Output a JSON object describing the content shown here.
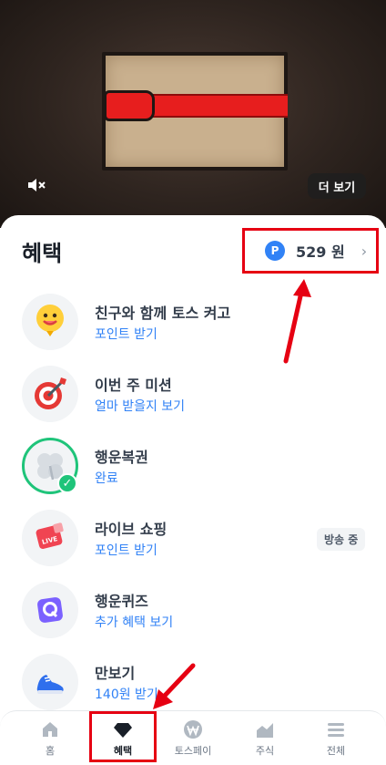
{
  "hero": {
    "more_label": "더 보기",
    "mute_icon": "speaker-muted-icon"
  },
  "benefits": {
    "title": "혜택",
    "points": {
      "badge": "P",
      "value": "529 원"
    },
    "items": [
      {
        "title": "친구와 함께 토스 켜고",
        "subtitle": "포인트 받기",
        "icon": "face-balloon-icon"
      },
      {
        "title": "이번 주 미션",
        "subtitle": "얼마 받을지 보기",
        "icon": "target-dart-icon"
      },
      {
        "title": "행운복권",
        "subtitle": "완료",
        "icon": "clover-icon",
        "done": true
      },
      {
        "title": "라이브 쇼핑",
        "subtitle": "포인트 받기",
        "icon": "live-shopping-icon",
        "badge": "방송 중"
      },
      {
        "title": "행운퀴즈",
        "subtitle": "추가 혜택 보기",
        "icon": "quiz-q-icon"
      },
      {
        "title": "만보기",
        "subtitle": "140원 받기",
        "icon": "sneaker-icon"
      }
    ]
  },
  "tabbar": {
    "tabs": [
      {
        "label": "홈",
        "icon": "home-icon"
      },
      {
        "label": "혜택",
        "icon": "gem-icon",
        "active": true
      },
      {
        "label": "토스페이",
        "icon": "won-coin-icon"
      },
      {
        "label": "주식",
        "icon": "chart-area-icon"
      },
      {
        "label": "전체",
        "icon": "menu-lines-icon"
      }
    ]
  },
  "colors": {
    "accent": "#3182f6",
    "annotation_red": "#e60012",
    "success": "#1fc47a"
  }
}
